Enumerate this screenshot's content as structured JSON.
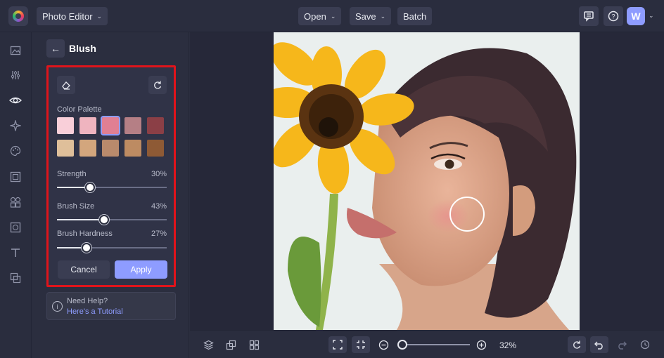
{
  "header": {
    "app_menu": "Photo Editor",
    "open_label": "Open",
    "save_label": "Save",
    "batch_label": "Batch",
    "avatar_letter": "W"
  },
  "panel": {
    "title": "Blush",
    "color_palette_label": "Color Palette",
    "palette": [
      [
        "#f9cfd9",
        "#efb4bf",
        "#e07f93",
        "#b57f85",
        "#8b3f46"
      ],
      [
        "#dfbf9a",
        "#d3a67d",
        "#b98a6c",
        "#bd8b62",
        "#8e5a35"
      ]
    ],
    "selected_swatch": "#e07f93",
    "sliders": [
      {
        "label": "Strength",
        "value": "30%",
        "fraction": 0.3
      },
      {
        "label": "Brush Size",
        "value": "43%",
        "fraction": 0.43
      },
      {
        "label": "Brush Hardness",
        "value": "27%",
        "fraction": 0.27
      }
    ],
    "cancel_label": "Cancel",
    "apply_label": "Apply",
    "help_title": "Need Help?",
    "help_link": "Here's a Tutorial"
  },
  "footer": {
    "zoom_value": "32%",
    "zoom_fraction": 0.05
  },
  "colors": {
    "accent": "#8e9cff",
    "highlight": "#e0141b"
  }
}
